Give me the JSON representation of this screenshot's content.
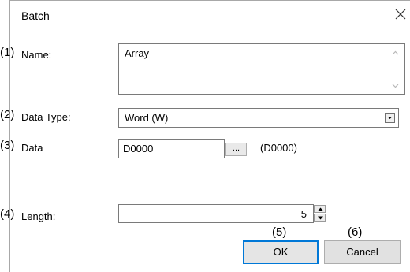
{
  "window": {
    "title": "Batch"
  },
  "annotations": [
    "(1)",
    "(2)",
    "(3)",
    "(4)",
    "(5)",
    "(6)"
  ],
  "fields": {
    "name": {
      "label": "Name:",
      "value": "Array"
    },
    "data_type": {
      "label": "Data Type:",
      "value": "Word (W)"
    },
    "data": {
      "label": "Data",
      "value": "D0000",
      "browse_label": "...",
      "resolved": "(D0000)"
    },
    "length": {
      "label": "Length:",
      "value": "5"
    }
  },
  "buttons": {
    "ok": "OK",
    "cancel": "Cancel"
  },
  "icons": {
    "close": "close-icon",
    "scroll_up": "scroll-up-icon",
    "scroll_down": "scroll-down-icon",
    "dropdown": "chevron-down-icon",
    "spin_up": "spin-up-icon",
    "spin_down": "spin-down-icon"
  },
  "colors": {
    "default_button_border": "#0078d7"
  }
}
